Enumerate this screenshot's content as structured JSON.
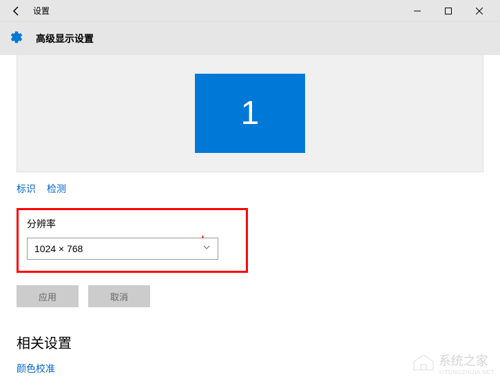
{
  "titlebar": {
    "title": "设置"
  },
  "header": {
    "heading": "高级显示设置"
  },
  "display": {
    "monitor_number": "1"
  },
  "links": {
    "identify": "标识",
    "detect": "检测"
  },
  "resolution": {
    "label": "分辨率",
    "value": "1024 × 768"
  },
  "buttons": {
    "apply": "应用",
    "cancel": "取消"
  },
  "related": {
    "heading": "相关设置",
    "color_calibration": "颜色校准"
  },
  "watermark": {
    "text": "系统之家",
    "sub": "XITONGZHIJIA.NET"
  }
}
